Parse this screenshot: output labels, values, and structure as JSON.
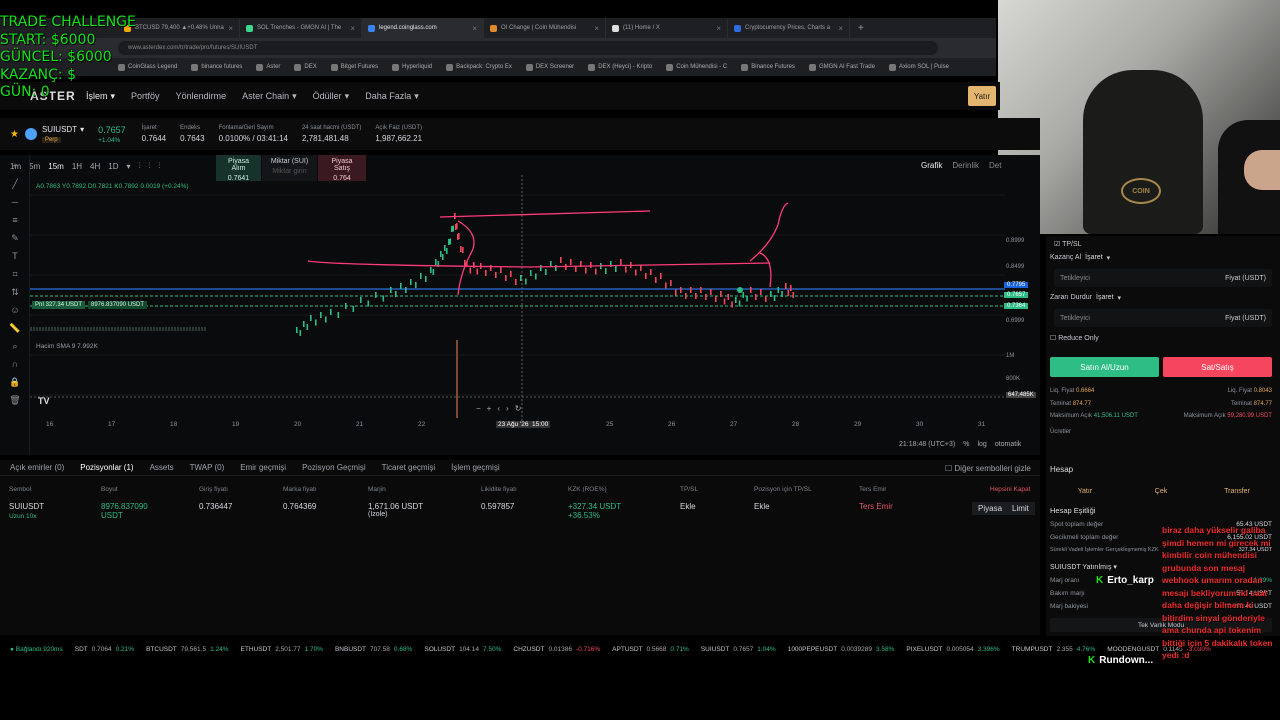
{
  "overlay": {
    "line1": "TRADE CHALLENGE",
    "line2": "START: $6000",
    "line3": "GÜNCEL: $6000",
    "line4": "KAZANÇ: $",
    "line5": "GÜN: 0"
  },
  "tabs": [
    {
      "label": "BTCUSD 79,400 ▲+0.48% Unna"
    },
    {
      "label": "SOL Trenches - GMGN AI | The"
    },
    {
      "label": "legend.coinglass.com"
    },
    {
      "label": "OI Change | Coin Mühendisi"
    },
    {
      "label": "(11) Home / X"
    },
    {
      "label": "Cryptocurrency Prices, Charts a"
    }
  ],
  "address": "www.asterdex.com/tr/trade/pro/futures/SUIUSDT",
  "bookmarks": [
    "CoinGlass Legend",
    "binance futures",
    "Aster",
    "DEX",
    "Bitget Futures",
    "Hyperliquid",
    "Backpack: Crypto Ex",
    "DEX Screener",
    "DEX (Heyci) - Kripto",
    "Coin Mühendisi - C",
    "Binance Futures",
    "GMGN AI Fast Trade",
    "Axiom SOL | Pulse"
  ],
  "nav": {
    "logo": "ASTER",
    "items": [
      "İşlem",
      "Portföy",
      "Yönlendirme",
      "Aster Chain",
      "Ödüller",
      "Daha Fazla"
    ],
    "deposit": "Yatır"
  },
  "ticker": {
    "symbol": "SUIUSDT",
    "type": "Perp",
    "price": "0.7657",
    "change": "+1.04%",
    "stats": [
      {
        "label": "İşaret",
        "value": "0.7644"
      },
      {
        "label": "Endeks",
        "value": "0.7643"
      },
      {
        "label": "Fonlama/Geri Sayım",
        "value": "0.0100% / 03:41:14"
      },
      {
        "label": "24 saat hacmi (USDT)",
        "value": "2,781,481.48"
      },
      {
        "label": "Açık Faiz (USDT)",
        "value": "1,987,662.21"
      }
    ]
  },
  "chart": {
    "timeframes": [
      "1m",
      "5m",
      "15m",
      "1H",
      "4H",
      "1D"
    ],
    "active_tf": "15m",
    "quick_buy_label": "Piyasa Alım",
    "quick_buy_price": "0.7641",
    "qty_label": "Miktar (SUI)",
    "qty_placeholder": "Miktar girin",
    "quick_sell_label": "Piyasa Satış",
    "quick_sell_price": "0.764",
    "views": [
      "Grafik",
      "Derinlik",
      "Det"
    ],
    "ohlc": "A0.7863 Y0.7892 D0.7821 K0.7892 0.0019 (+0.24%)",
    "volume_label": "Hacim SMA 9  7.992K",
    "position_tag": "PnI 327.34 USDT",
    "position_size_tag": "8976.837090 USDT",
    "price_ticks": [
      "0.8999",
      "0.8499",
      "0.7999",
      "0.6999"
    ],
    "price_tags": [
      "0.7795",
      "0.7657",
      "0.7364"
    ],
    "volume_ticks": [
      "1M",
      "800K",
      "647,485K"
    ],
    "date_ticks": [
      "16",
      "17",
      "18",
      "19",
      "20",
      "21",
      "22",
      "23",
      "23 Ağu '26",
      "25",
      "26",
      "27",
      "28",
      "29",
      "30",
      "31"
    ],
    "crosshair_time": "15:00",
    "time_display": "21:18:48 (UTC+3)",
    "log_label": "log",
    "auto_label": "otomatik"
  },
  "positions": {
    "tabs": [
      "Açık emirler (0)",
      "Pozisyonlar (1)",
      "Assets",
      "TWAP (0)",
      "Emir geçmişi",
      "Pozisyon Geçmişi",
      "Ticaret geçmişi",
      "İşlem geçmişi"
    ],
    "active_tab": 1,
    "hide_others": "Diğer sembolleri gizle",
    "headers": [
      "Sembol",
      "Boyut",
      "Giriş fiyatı",
      "Marka fiyatı",
      "Marjin",
      "Likidite fiyatı",
      "KZK (ROE%)",
      "TP/SL",
      "Pozisyon için TP/SL",
      "Ters Emir",
      "Hepsini Kapat"
    ],
    "row": {
      "symbol": "SUIUSDT",
      "sub": "Uzun 10x",
      "size": "8976.837090",
      "size_unit": "USDT",
      "entry": "0.736447",
      "mark": "0.764369",
      "margin": "1,671.06 USDT",
      "margin_mode": "(İzole)",
      "liq": "0.597857",
      "pnl": "+327.34 USDT",
      "roe": "+36.53%",
      "tpsl": "Ekle",
      "pos_tpsl": "Ekle",
      "reverse": "Ters Emir",
      "market": "Piyasa",
      "limit": "Limit"
    }
  },
  "status": {
    "connection": "Bağlandı 920ms",
    "pairs": [
      {
        "n": "SDT",
        "p": "0.7064",
        "c": "0.21%"
      },
      {
        "n": "BTCUSDT",
        "p": "79,561.5",
        "c": "1.24%"
      },
      {
        "n": "ETHUSDT",
        "p": "2,501.77",
        "c": "1.70%"
      },
      {
        "n": "BNBUSDT",
        "p": "707.58",
        "c": "0.68%"
      },
      {
        "n": "SOLUSDT",
        "p": "104.14",
        "c": "7.50%"
      },
      {
        "n": "CHZUSDT",
        "p": "0.01386",
        "c": "-0.716%"
      },
      {
        "n": "APTUSDT",
        "p": "0.5668",
        "c": "0.71%"
      },
      {
        "n": "SUIUSDT",
        "p": "0.7657",
        "c": "1.04%"
      },
      {
        "n": "1000PEPEUSDT",
        "p": "0.0039289",
        "c": "3.58%"
      },
      {
        "n": "PIXELUSDT",
        "p": "0.005054",
        "c": "3.396%"
      },
      {
        "n": "TRUMPUSDT",
        "p": "2.355",
        "c": "4.76%"
      },
      {
        "n": "MOODENGUSDT",
        "p": "0.1145",
        "c": "-3.030%"
      }
    ]
  },
  "order_panel": {
    "tpsl": "TP/SL",
    "tp_label": "Kazanç Al",
    "tp_mark": "İşaret",
    "tp_placeholder": "Tetikleyici",
    "tp_unit": "Fiyat (USDT)",
    "sl_label": "Zararı Durdur",
    "sl_mark": "İşaret",
    "sl_placeholder": "Tetikleyici",
    "sl_unit": "Fiyat (USDT)",
    "reduce_only": "Reduce Only",
    "buy": "Satın Al/Uzun",
    "sell": "Sat/Satış",
    "liq_buy_label": "Liq. Fiyat",
    "liq_buy": "0.6664",
    "liq_sell_label": "Liq. Fiyat",
    "liq_sell": "0.8043",
    "margin_buy_label": "Teminat",
    "margin_buy": "874.77",
    "margin_sell_label": "Teminat",
    "margin_sell": "874.77",
    "max_buy_label": "Maksimum Açık",
    "max_buy": "41,506.11 USDT",
    "max_sell_label": "Maksimum Açık",
    "max_sell": "59,280.99 USDT",
    "fees": "Ücretler",
    "account": "Hesap",
    "deposit": "Yatır",
    "withdraw": "Çek",
    "transfer": "Transfer",
    "equity": "Hesap Eşitliği",
    "spot_label": "Spot toplam değer",
    "spot_value": "65.43 USDT",
    "futures_label": "Gecikmeli toplam değer",
    "futures_value": "6,155.02 USDT",
    "unrealized_label": "Sürekli Vadeli İşlemler Gerçekleşmemiş KZK",
    "unrealized_value": "327.34 USDT",
    "symbol_margin": "SUIUSDT Yatırılmış",
    "margin_ratio_label": "Marj oranı",
    "margin_ratio_value": "1.29%",
    "maint_label": "Bakım marjı",
    "maint_value": "59.14 USDT",
    "margin_balance_label": "Marj bakiyesi",
    "margin_balance_value": "1,998.41 USDT",
    "single_mode": "Tek Varlık Modu"
  },
  "chat": {
    "user1": "Erto_karp",
    "user2": "Rundown...",
    "message": "biraz daha yükselir galiba şimdi hemen mi girecek mi kimbilir coin mühendisi grubunda son mesaj webhook umarım oradan mesajı bekliyorum iki saat daha değişir bilmem ki bitirdim sinyal gönderiyle ama  chunda api tokenim bittiği için 5 dakikalık token yedi :d"
  }
}
